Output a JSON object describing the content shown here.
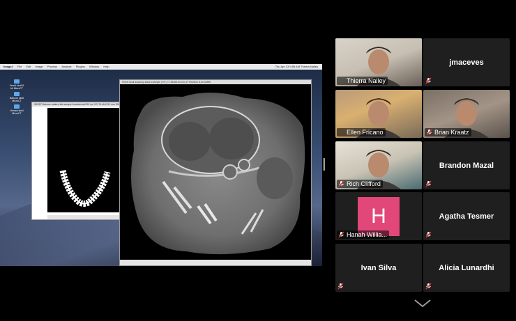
{
  "share": {
    "menubar": {
      "apple": "",
      "app": "ImageJ",
      "menus": [
        "File",
        "Edit",
        "Image",
        "Process",
        "Analyze",
        "Plugins",
        "Window",
        "Help"
      ],
      "status": "Thu Apr 23 9:56 AM  Thierra Nalley"
    },
    "desktop_icons": [
      {
        "label": "Ferret skull 8 bit MicroCT"
      },
      {
        "label": "Baboon skull MicroCT"
      },
      {
        "label": "Human skull MicroCT"
      }
    ],
    "small_window": {
      "title": "28/257 Baboon mature tab sample transformed100 um 127.21x140.31 mm 3062x..."
    },
    "large_window": {
      "title": "Ferret skull anatomy stack example (TIF) 71.35x68.63 mm 2779x2631 8-bit 43MB",
      "subtitle": "Ferret skull anatomy"
    }
  },
  "participants": [
    {
      "name": "Thierra Nalley",
      "video": true,
      "speaking": true,
      "muted": false
    },
    {
      "name": "jmaceves",
      "video": false,
      "speaking": false,
      "muted": true
    },
    {
      "name": "Ellen Fricano",
      "video": true,
      "speaking": false,
      "muted": false
    },
    {
      "name": "Brian Kraatz",
      "video": true,
      "speaking": false,
      "muted": true
    },
    {
      "name": "Rich Clifford",
      "video": true,
      "speaking": false,
      "muted": true
    },
    {
      "name": "Brandon Mazal",
      "video": false,
      "speaking": false,
      "muted": true
    },
    {
      "name": "Hanah Willia...",
      "video": false,
      "avatar_letter": "H",
      "avatar_color": "#e2477a",
      "speaking": false,
      "muted": true
    },
    {
      "name": "Agatha Tesmer",
      "video": false,
      "speaking": false,
      "muted": true
    },
    {
      "name": "Ivan Silva",
      "video": false,
      "speaking": false,
      "muted": true
    },
    {
      "name": "Alicia Lunardhi",
      "video": false,
      "speaking": false,
      "muted": true
    }
  ],
  "colors": {
    "speaking_outline": "#c8e03c",
    "muted_red": "#e0342c",
    "tile_bg": "#1f1f1f"
  }
}
